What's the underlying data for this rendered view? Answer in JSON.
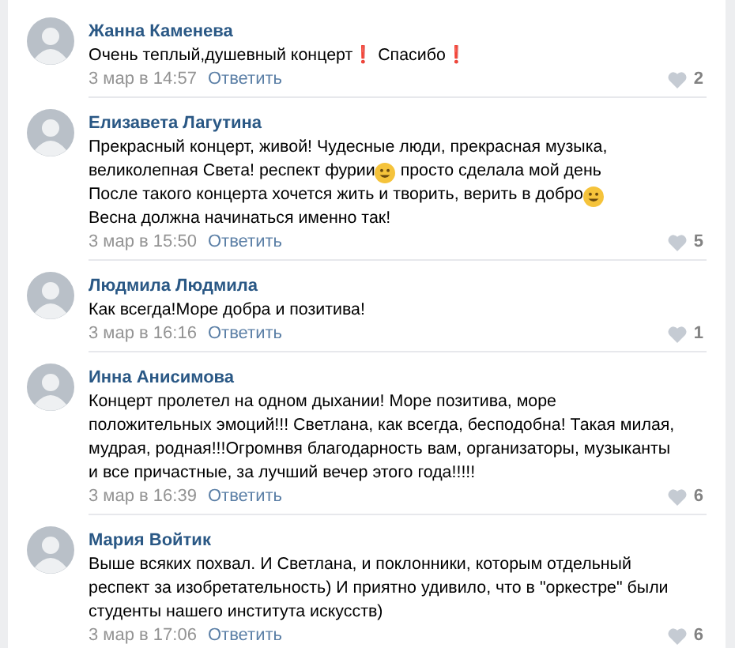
{
  "comments": [
    {
      "author": "Жанна Каменева",
      "text": [
        [
          {
            "kind": "text",
            "text": "Очень теплый,душевный концерт❗ Спасибо❗"
          }
        ]
      ],
      "date": "3 мар в 14:57",
      "reply": "Ответить",
      "likes": "2"
    },
    {
      "author": "Елизавета Лагутина",
      "text": [
        [
          {
            "kind": "text",
            "text": "Прекрасный концерт, живой! Чудесные люди, прекрасная музыка,"
          }
        ],
        [
          {
            "kind": "text",
            "text": "великолепная Света! респект фурии"
          },
          {
            "kind": "emoji"
          },
          {
            "kind": "text",
            "text": " просто сделала мой день"
          }
        ],
        [
          {
            "kind": "text",
            "text": "После такого концерта хочется жить и творить, верить в добро"
          },
          {
            "kind": "emoji"
          }
        ],
        [
          {
            "kind": "text",
            "text": "Весна должна начинаться именно так!"
          }
        ]
      ],
      "date": "3 мар в 15:50",
      "reply": "Ответить",
      "likes": "5"
    },
    {
      "author": "Людмила Людмила",
      "text": [
        [
          {
            "kind": "text",
            "text": "Как всегда!Море добра и позитива!"
          }
        ]
      ],
      "date": "3 мар в 16:16",
      "reply": "Ответить",
      "likes": "1"
    },
    {
      "author": "Инна Анисимова",
      "text": [
        [
          {
            "kind": "text",
            "text": "Концерт пролетел на одном дыхании! Море позитива, море"
          }
        ],
        [
          {
            "kind": "text",
            "text": "положительных эмоций!!! Светлана, как всегда, бесподобна! Такая милая,"
          }
        ],
        [
          {
            "kind": "text",
            "text": "мудрая, родная!!!Огромнвя благодарность вам, организаторы, музыканты"
          }
        ],
        [
          {
            "kind": "text",
            "text": "и все причастные, за лучший вечер этого года!!!!!"
          }
        ]
      ],
      "date": "3 мар в 16:39",
      "reply": "Ответить",
      "likes": "6"
    },
    {
      "author": "Мария Войтик",
      "text": [
        [
          {
            "kind": "text",
            "text": "Выше всяких похвал. И Светлана, и поклонники, которым отдельный"
          }
        ],
        [
          {
            "kind": "text",
            "text": "респект за изобретательность) И приятно удивило, что в \"оркестре\" были"
          }
        ],
        [
          {
            "kind": "text",
            "text": "студенты нашего института искусств)"
          }
        ]
      ],
      "date": "3 мар в 17:06",
      "reply": "Ответить",
      "likes": "6"
    }
  ]
}
